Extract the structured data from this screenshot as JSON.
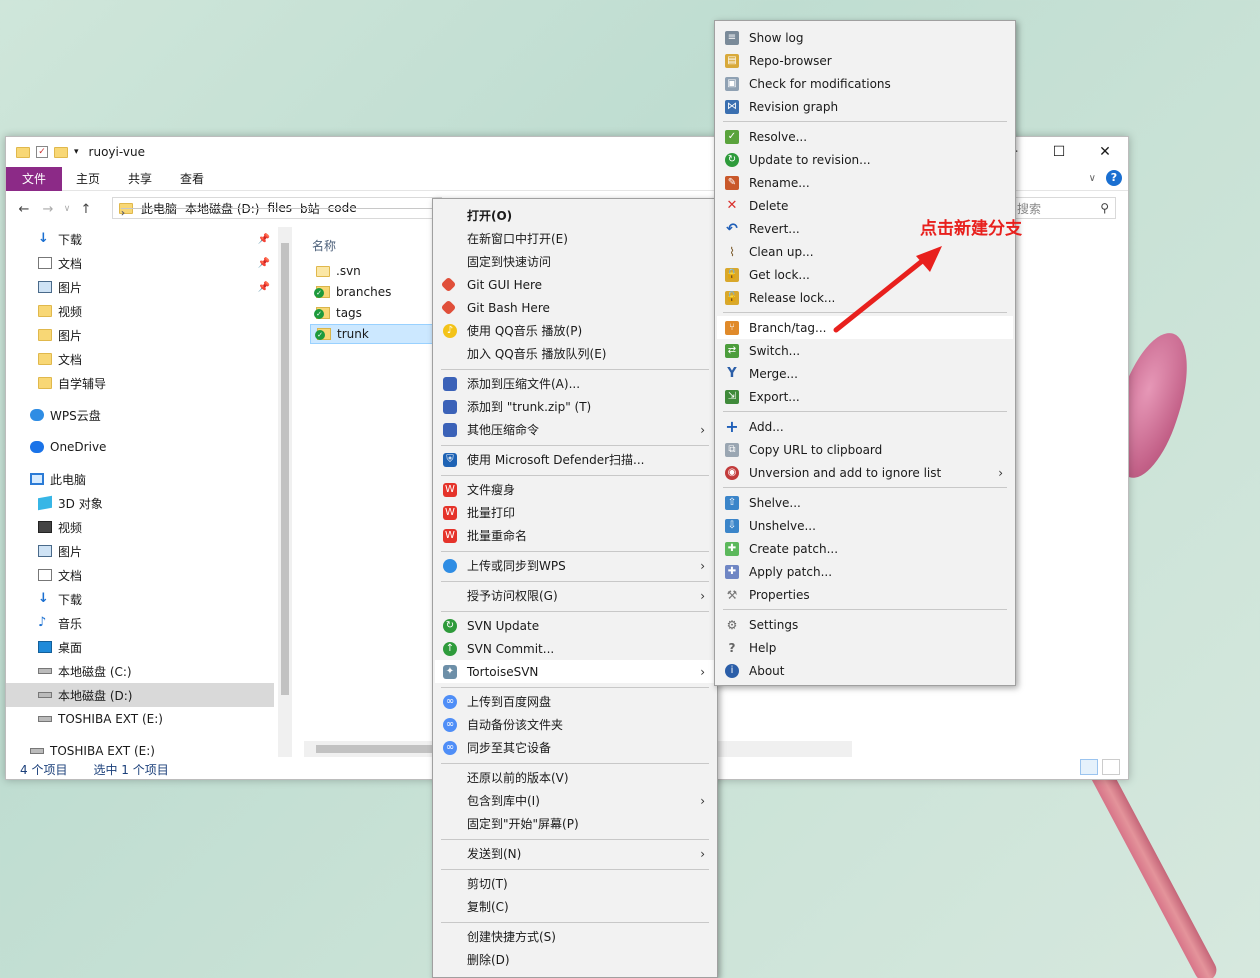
{
  "colors": {
    "accent": "#8c2a87",
    "annotation": "#e8201d",
    "selection": "#cce8ff"
  },
  "explorer": {
    "title": "ruoyi-vue",
    "ribbon_tabs": [
      "文件",
      "主页",
      "共享",
      "查看"
    ],
    "breadcrumb": [
      "此电脑",
      "本地磁盘 (D:)",
      "files",
      "b站",
      "code"
    ],
    "search_placeholder": "搜索",
    "column_header": "名称",
    "files": [
      ".svn",
      "branches",
      "tags",
      "trunk"
    ],
    "status_count": "4 个项目",
    "status_selected": "选中 1 个项目"
  },
  "sidebar": {
    "items": [
      "下载",
      "文档",
      "图片",
      "视频",
      "图片",
      "文档",
      "自学辅导",
      "WPS云盘",
      "OneDrive",
      "此电脑",
      "3D 对象",
      "视频",
      "图片",
      "文档",
      "下载",
      "音乐",
      "桌面",
      "本地磁盘 (C:)",
      "本地磁盘 (D:)",
      "TOSHIBA EXT (E:)",
      "TOSHIBA EXT (E:)"
    ]
  },
  "context_menu": {
    "items": [
      "打开(O)",
      "在新窗口中打开(E)",
      "固定到快速访问",
      "Git GUI Here",
      "Git Bash Here",
      "使用 QQ音乐 播放(P)",
      "加入 QQ音乐 播放队列(E)",
      "添加到压缩文件(A)...",
      "添加到 \"trunk.zip\" (T)",
      "其他压缩命令",
      "使用 Microsoft Defender扫描...",
      "文件瘦身",
      "批量打印",
      "批量重命名",
      "上传或同步到WPS",
      "授予访问权限(G)",
      "SVN Update",
      "SVN Commit...",
      "TortoiseSVN",
      "上传到百度网盘",
      "自动备份该文件夹",
      "同步至其它设备",
      "还原以前的版本(V)",
      "包含到库中(I)",
      "固定到\"开始\"屏幕(P)",
      "发送到(N)",
      "剪切(T)",
      "复制(C)",
      "创建快捷方式(S)",
      "删除(D)"
    ]
  },
  "svn_menu": {
    "items": [
      "Show log",
      "Repo-browser",
      "Check for modifications",
      "Revision graph",
      "Resolve...",
      "Update to revision...",
      "Rename...",
      "Delete",
      "Revert...",
      "Clean up...",
      "Get lock...",
      "Release lock...",
      "Branch/tag...",
      "Switch...",
      "Merge...",
      "Export...",
      "Add...",
      "Copy URL to clipboard",
      "Unversion and add to ignore list",
      "Shelve...",
      "Unshelve...",
      "Create patch...",
      "Apply patch...",
      "Properties",
      "Settings",
      "Help",
      "About"
    ]
  },
  "annotation": "点击新建分支"
}
